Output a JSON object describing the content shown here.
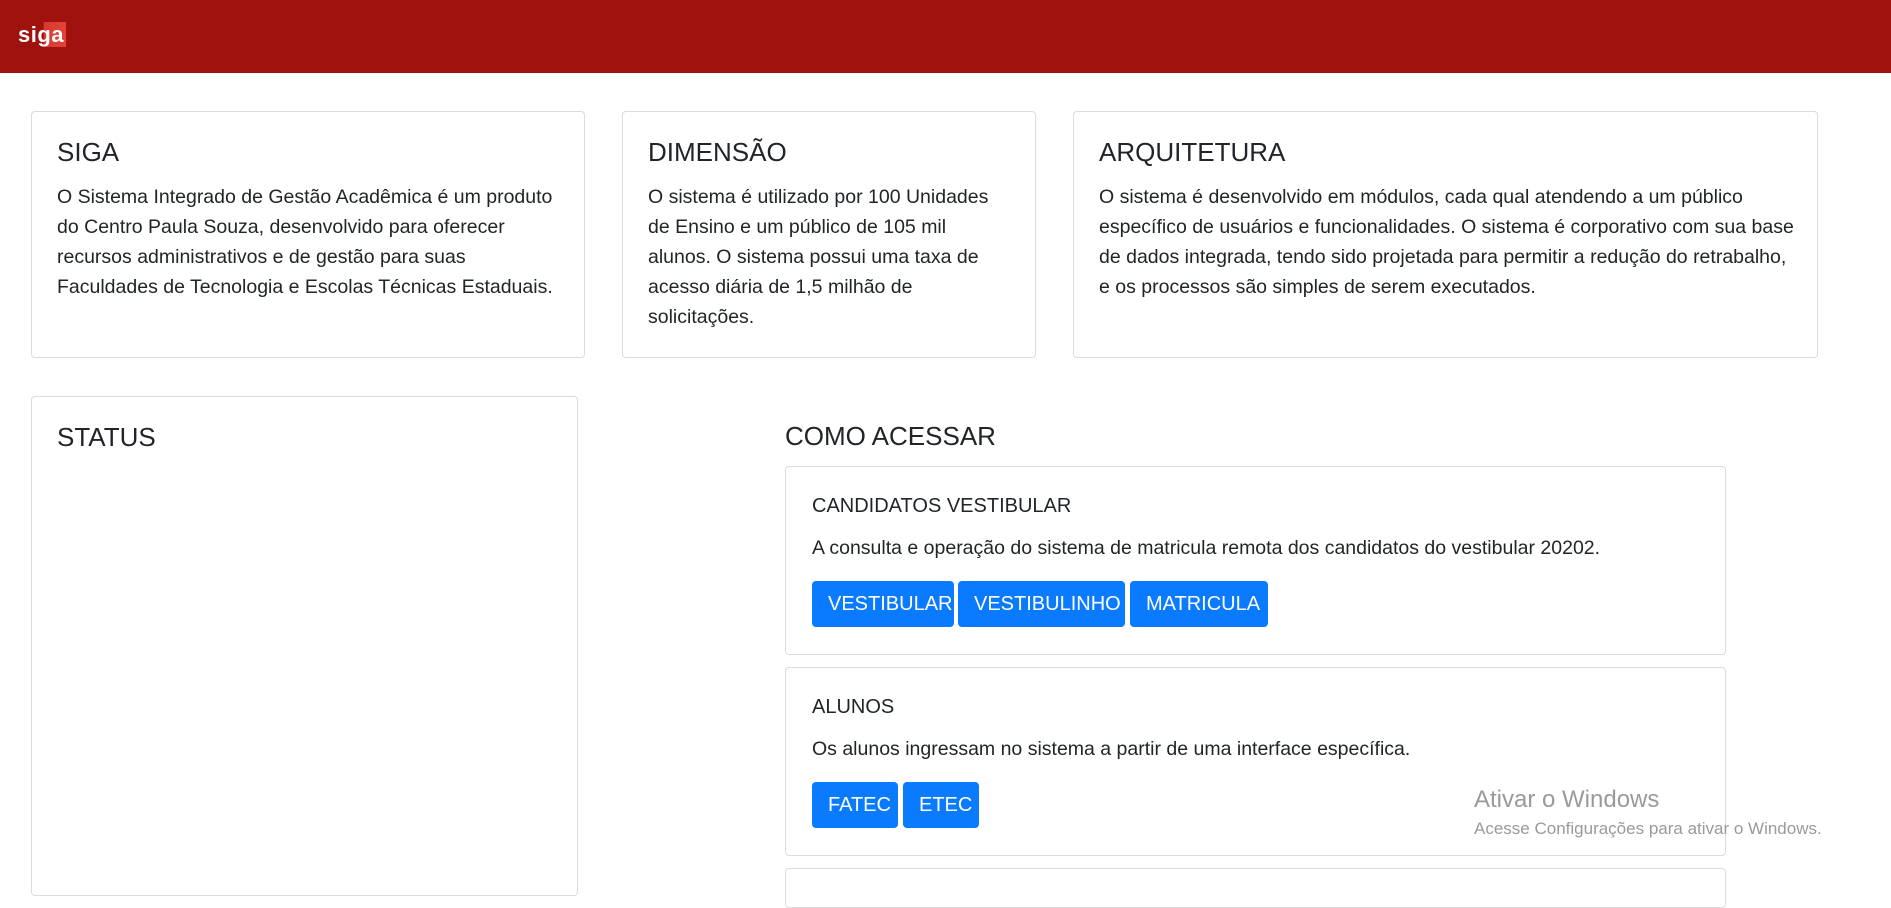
{
  "navbar": {
    "brand": "siga",
    "brand_color": "#a0120e"
  },
  "info_cards": [
    {
      "title": "SIGA",
      "text": "O Sistema Integrado de Gestão Acadêmica é um produto do Centro Paula Souza, desenvolvido para oferecer recursos administrativos e de gestão para suas Faculdades de Tecnologia e Escolas Técnicas Estaduais."
    },
    {
      "title": "DIMENSÃO",
      "text": "O sistema é utilizado por 100 Unidades de Ensino e um público de 105 mil alunos. O sistema possui uma taxa de acesso diária de 1,5 milhão de solicitações."
    },
    {
      "title": "ARQUITETURA",
      "text": "O sistema é desenvolvido em módulos, cada qual atendendo a um público específico de usuários e funcionalidades. O sistema é corporativo com sua base de dados integrada, tendo sido projetada para permitir a redução do retrabalho, e os processos são simples de serem executados."
    }
  ],
  "status": {
    "title": "STATUS"
  },
  "access": {
    "title": "COMO ACESSAR",
    "cards": [
      {
        "title": "CANDIDATOS VESTIBULAR",
        "text": "A consulta e operação do sistema de matricula remota dos candidatos do vestibular 20202.",
        "buttons": [
          "VESTIBULAR",
          "VESTIBULINHO",
          "MATRICULA"
        ]
      },
      {
        "title": "ALUNOS",
        "text": "Os alunos ingressam no sistema a partir de uma interface específica.",
        "buttons": [
          "FATEC",
          "ETEC"
        ]
      }
    ]
  },
  "button_color": "#0a7bff",
  "watermark": {
    "title": "Ativar o Windows",
    "subtitle": "Acesse Configurações para ativar o Windows."
  }
}
